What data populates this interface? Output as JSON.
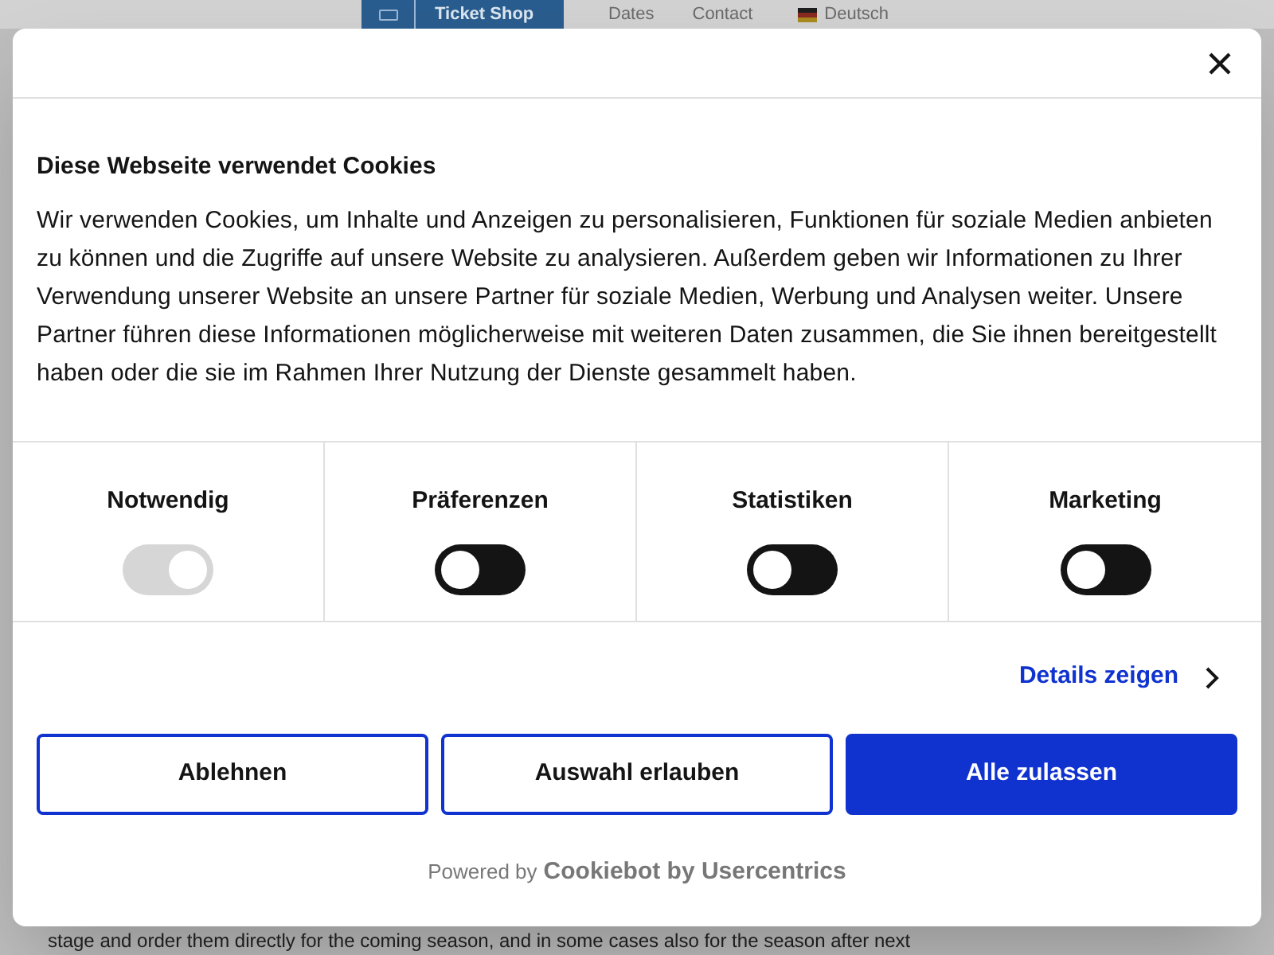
{
  "site_nav": {
    "ticket_shop": "Ticket Shop",
    "links": [
      "Dates",
      "Contact"
    ],
    "language": "Deutsch"
  },
  "background_text": "stage and order them directly for the coming season, and in some cases also for the season after next",
  "dialog": {
    "title": "Diese Webseite verwendet Cookies",
    "body": "Wir verwenden Cookies, um Inhalte und Anzeigen zu personalisieren, Funktionen für soziale Medien anbieten zu können und die Zugriffe auf unsere Website zu analysieren. Außerdem geben wir Informationen zu Ihrer Verwendung unserer Website an unsere Partner für soziale Medien, Werbung und Analysen weiter. Unsere Partner führen diese Informationen möglicherweise mit weiteren Daten zusammen, die Sie ihnen bereitgestellt haben oder die sie im Rahmen Ihrer Nutzung der Dienste gesammelt haben.",
    "categories": [
      {
        "label": "Notwendig",
        "checked": true,
        "disabled": true
      },
      {
        "label": "Präferenzen",
        "checked": false,
        "disabled": false
      },
      {
        "label": "Statistiken",
        "checked": false,
        "disabled": false
      },
      {
        "label": "Marketing",
        "checked": false,
        "disabled": false
      }
    ],
    "details_link": "Details zeigen",
    "buttons": [
      {
        "label": "Ablehnen",
        "kind": "outline"
      },
      {
        "label": "Auswahl erlauben",
        "kind": "outline"
      },
      {
        "label": "Alle zulassen",
        "kind": "primary"
      }
    ],
    "powered_by": {
      "prefix": "Powered by",
      "brand": "Cookiebot by Usercentrics"
    }
  }
}
